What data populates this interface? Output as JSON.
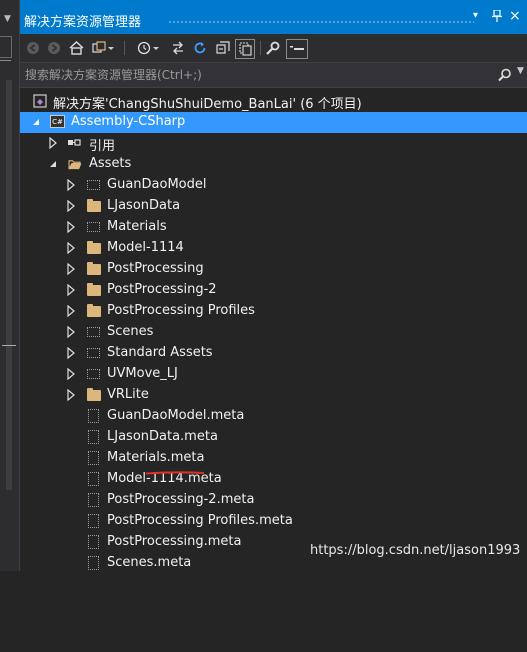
{
  "window": {
    "title": "解决方案资源管理器",
    "controls": [
      "▾",
      "⊓",
      "×"
    ]
  },
  "toolbar": {
    "buttons": [
      "back-icon",
      "forward-icon",
      "home-icon",
      "switch-views-icon",
      "history-icon",
      "sync-icon",
      "refresh-icon",
      "collapse-all-icon",
      "show-all-files-icon",
      "properties-icon",
      "preview-icon"
    ]
  },
  "search": {
    "placeholder": "搜索解决方案资源管理器(Ctrl+;)"
  },
  "tree": {
    "solution": "解决方案'ChangShuShuiDemo_BanLai' (6 个项目)",
    "project": "Assembly-CSharp",
    "references": "引用",
    "assets": "Assets",
    "folders": [
      "GuanDaoModel",
      "LJasonData",
      "Materials",
      "Model-1114",
      "PostProcessing",
      "PostProcessing-2",
      "PostProcessing Profiles",
      "Scenes",
      "Standard Assets",
      "UVMove_LJ",
      "VRLite"
    ],
    "meta_files": [
      "GuanDaoModel.meta",
      "LJasonData.meta",
      "Materials.meta",
      "Model-1114.meta",
      "PostProcessing-2.meta",
      "PostProcessing Profiles.meta",
      "PostProcessing.meta",
      "Scenes.meta"
    ]
  },
  "watermark": "https://blog.csdn.net/ljason1993",
  "colors": {
    "accent": "#007acc",
    "selection": "#3399ff",
    "folder": "#dcb67a",
    "annotation": "#e0302a",
    "background": "#252526"
  }
}
